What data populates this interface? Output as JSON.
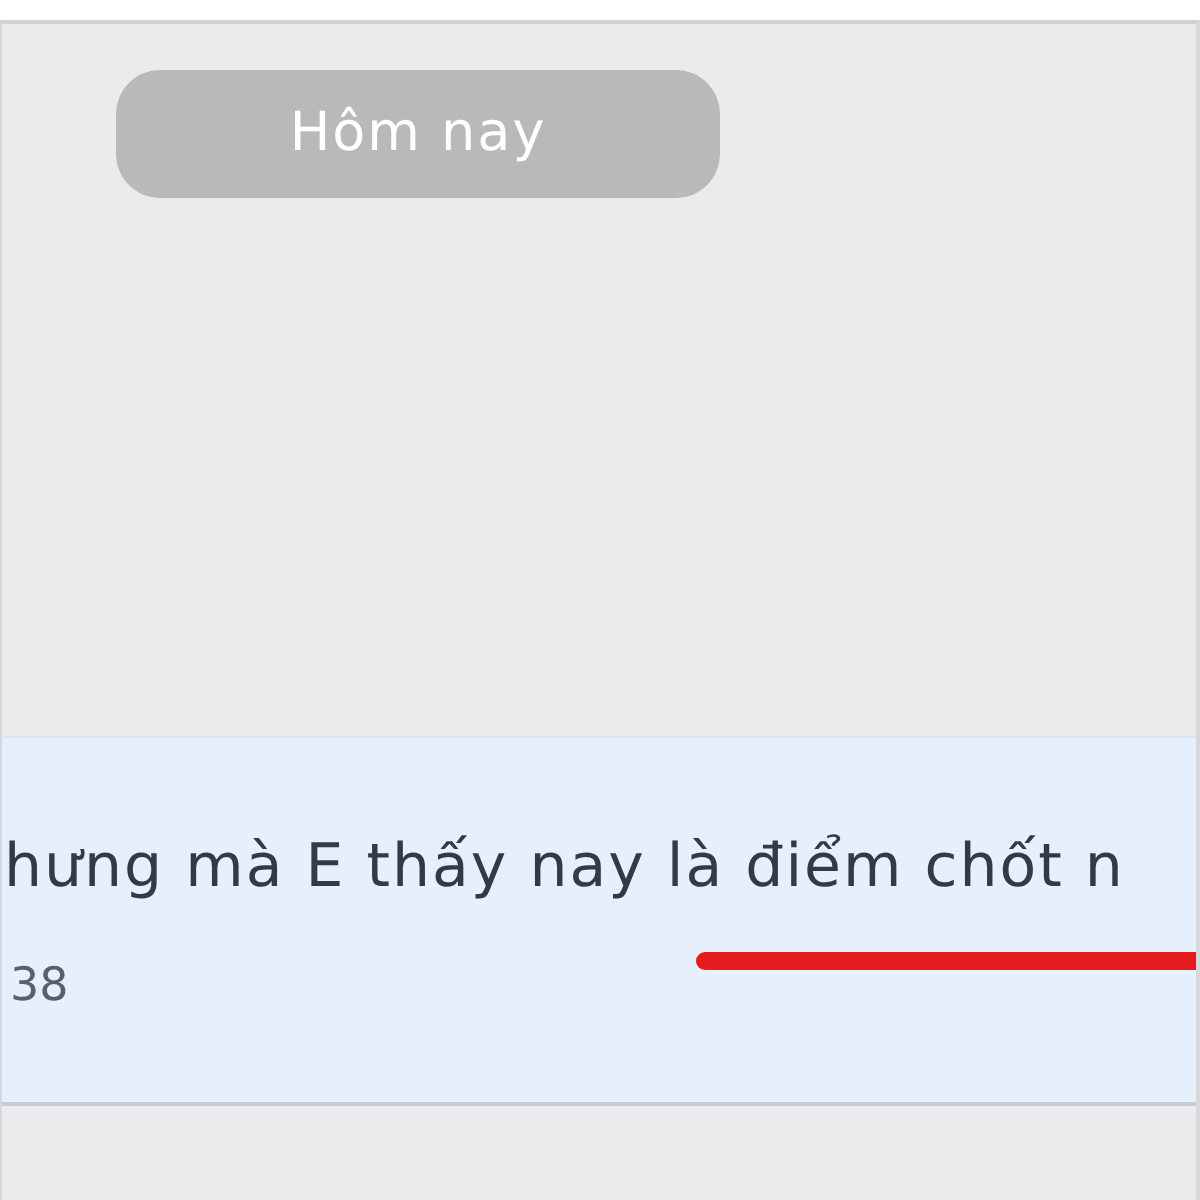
{
  "date_separator": {
    "label": "Hôm nay"
  },
  "message": {
    "text": "hưng mà E thấy nay là điểm chốt n",
    "time": "38"
  }
}
